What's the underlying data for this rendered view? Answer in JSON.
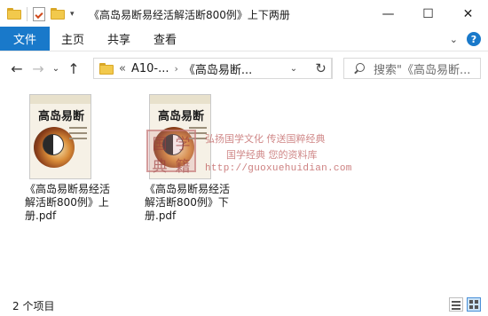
{
  "window": {
    "title": "《高岛易断易经活解活断800例》上下两册",
    "controls": {
      "minimize_icon": "—",
      "maximize_icon": "☐",
      "close_icon": "✕"
    }
  },
  "quick_access": {
    "dropdown_icon": "▾"
  },
  "ribbon": {
    "file_tab": "文件",
    "tabs": [
      "主页",
      "共享",
      "查看"
    ],
    "expand_icon": "⌄",
    "help_icon": "?"
  },
  "nav": {
    "back_icon": "←",
    "forward_icon": "→",
    "history_icon": "⌄",
    "up_icon": "↑",
    "overflow": "«",
    "crumbs": [
      "A10-...",
      "《高岛易断..."
    ],
    "crumb_separator": "›",
    "address_dropdown_icon": "⌄",
    "refresh_icon": "↻",
    "search_placeholder": "搜索\"《高岛易断..."
  },
  "files": [
    {
      "label": "《高岛易断易经活解活断800例》上册.pdf",
      "thumb_title": "高岛易断"
    },
    {
      "label": "《高岛易断易经活解活断800例》下册.pdf",
      "thumb_title": "高岛易断"
    }
  ],
  "watermark": {
    "seal_chars": [
      "国",
      "学",
      "典",
      "籍"
    ],
    "line1": "弘扬国学文化 传送国粹经典",
    "line2": "国学经典 您的资料库",
    "url": "http://guoxuehuidian.com"
  },
  "status": {
    "item_count": "2 个项目"
  }
}
